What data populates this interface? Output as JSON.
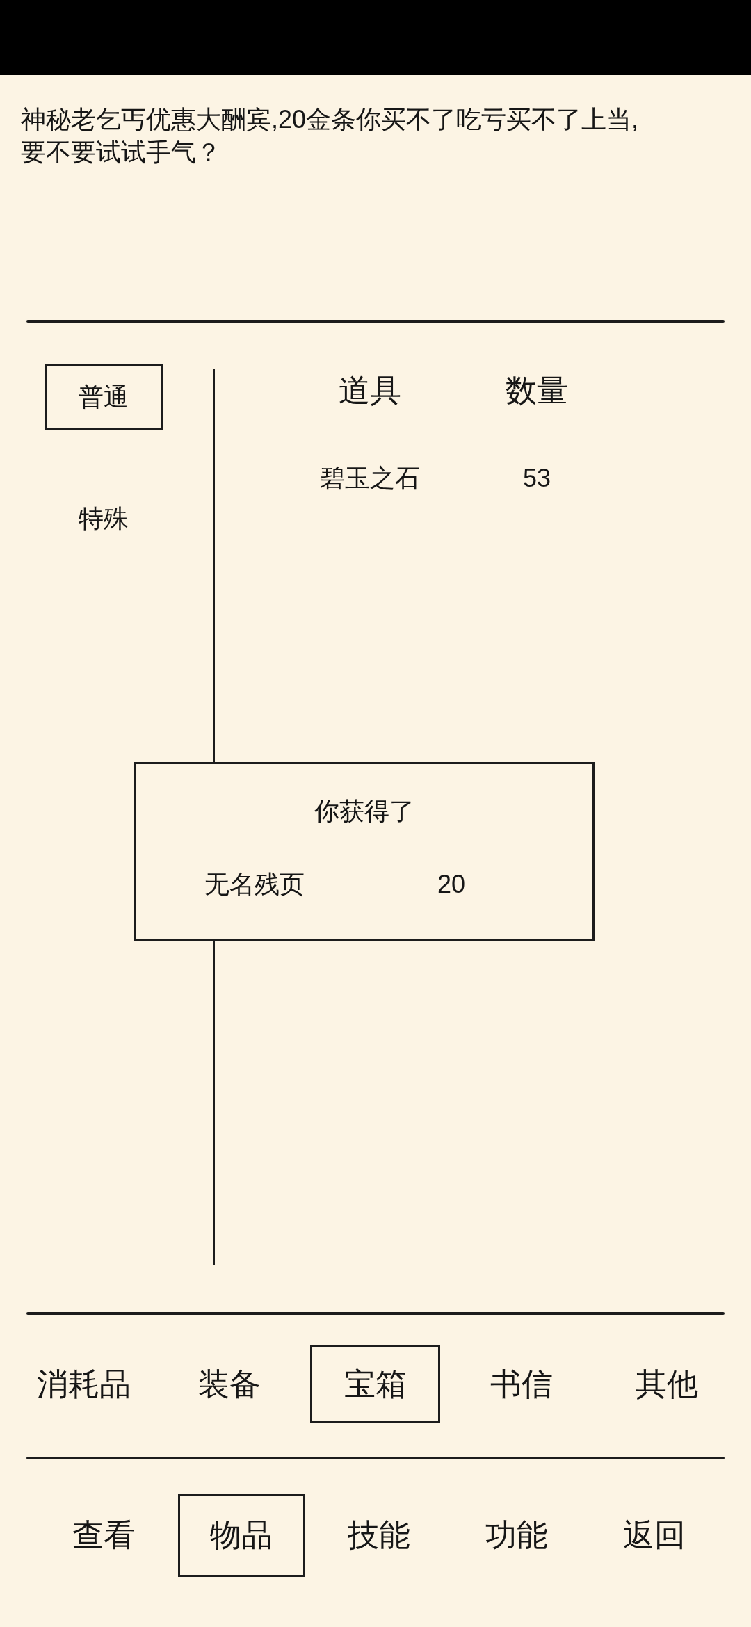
{
  "message": "神秘老乞丐优惠大酬宾,20金条你买不了吃亏买不了上当,\n要不要试试手气？",
  "subtabs": [
    {
      "label": "普通",
      "selected": true
    },
    {
      "label": "特殊",
      "selected": false
    }
  ],
  "table": {
    "columns": [
      "道具",
      "数量"
    ],
    "rows": [
      [
        "碧玉之石",
        "53"
      ]
    ]
  },
  "dialog": {
    "title": "你获得了",
    "items": [
      {
        "name": "无名残页",
        "count": "20"
      }
    ]
  },
  "category_tabs": [
    {
      "label": "消耗品",
      "selected": false
    },
    {
      "label": "装备",
      "selected": false
    },
    {
      "label": "宝箱",
      "selected": true
    },
    {
      "label": "书信",
      "selected": false
    },
    {
      "label": "其他",
      "selected": false
    }
  ],
  "nav_tabs": [
    {
      "label": "查看",
      "selected": false
    },
    {
      "label": "物品",
      "selected": true
    },
    {
      "label": "技能",
      "selected": false
    },
    {
      "label": "功能",
      "selected": false
    },
    {
      "label": "返回",
      "selected": false
    }
  ]
}
